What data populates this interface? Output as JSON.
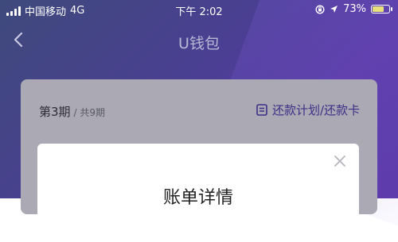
{
  "status_bar": {
    "carrier": "中国移动",
    "network": "4G",
    "time": "下午 2:02",
    "battery_text": "73%",
    "battery_level": 0.73
  },
  "nav": {
    "title": "U钱包"
  },
  "card": {
    "period_label": "第3期",
    "period_total": "/ 共9期",
    "plan_link": "还款计划/还款卡"
  },
  "modal": {
    "title": "账单详情"
  },
  "colors": {
    "accent": "#3e2e86",
    "background": "#4a3f92",
    "card": "#aaa9b4"
  },
  "icons": [
    "signal-icon",
    "lock-rotation-icon",
    "location-arrow-icon",
    "battery-icon",
    "back-icon",
    "list-icon",
    "close-icon"
  ]
}
